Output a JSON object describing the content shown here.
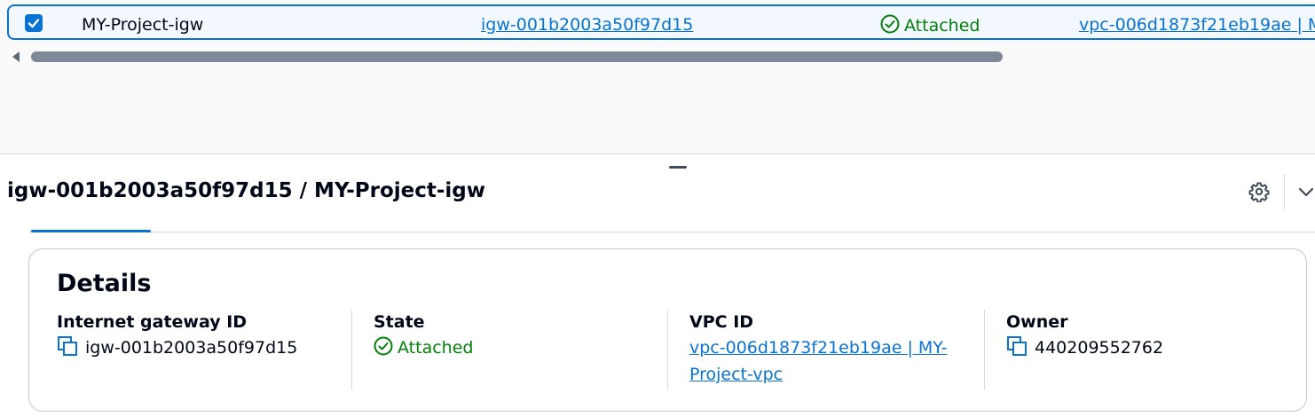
{
  "table": {
    "selected_row": {
      "name": "MY-Project-igw",
      "gateway_id": "igw-001b2003a50f97d15",
      "state": "Attached",
      "vpc": "vpc-006d1873f21eb19ae | M"
    }
  },
  "split_panel": {
    "title": "igw-001b2003a50f97d15 / MY-Project-igw",
    "icons": {
      "settings": "gear-icon",
      "collapse": "chevron-down-icon"
    }
  },
  "details": {
    "heading": "Details",
    "fields": [
      {
        "label": "Internet gateway ID",
        "value": "igw-001b2003a50f97d15"
      },
      {
        "label": "State",
        "value": "Attached"
      },
      {
        "label": "VPC ID",
        "value_line1": "vpc-006d1873f21eb19ae | MY-",
        "value_line2": "Project-vpc"
      },
      {
        "label": "Owner",
        "value": "440209552762"
      }
    ]
  },
  "colors": {
    "accent": "#0972d3",
    "success": "#037f0c",
    "text": "#000716"
  }
}
